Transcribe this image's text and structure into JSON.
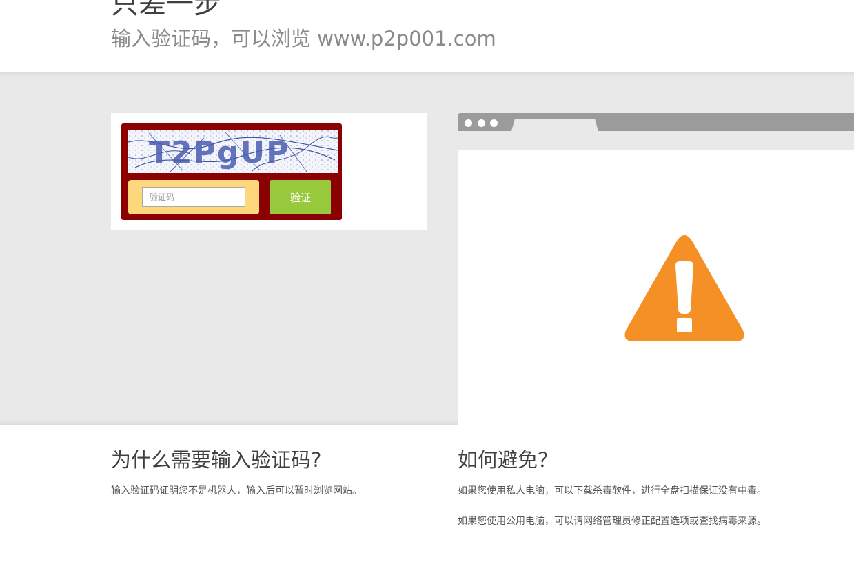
{
  "header": {
    "title": "只差一步",
    "subtitle": "输入验证码，可以浏览 www.p2p001.com"
  },
  "captcha": {
    "image_text": "T2PgUP",
    "input_placeholder": "验证码",
    "input_value": "",
    "verify_label": "验证"
  },
  "browser_mockup": {
    "icon": "warning-triangle-icon",
    "accent": "#f49025"
  },
  "why": {
    "heading": "为什么需要输入验证码?",
    "text": "输入验证码证明您不是机器人，输入后可以暂时浏览网站。"
  },
  "how": {
    "heading": "如何避免？",
    "text1": "如果您使用私人电脑，可以下载杀毒软件，进行全盘扫描保证没有中毒。",
    "text2": "如果您使用公用电脑，可以请网络管理员修正配置选项或查找病毒来源。"
  },
  "colors": {
    "captcha_frame": "#8b0000",
    "input_bg": "#fdd77b",
    "verify_btn": "#98c93c",
    "band": "#e9e9e9"
  }
}
